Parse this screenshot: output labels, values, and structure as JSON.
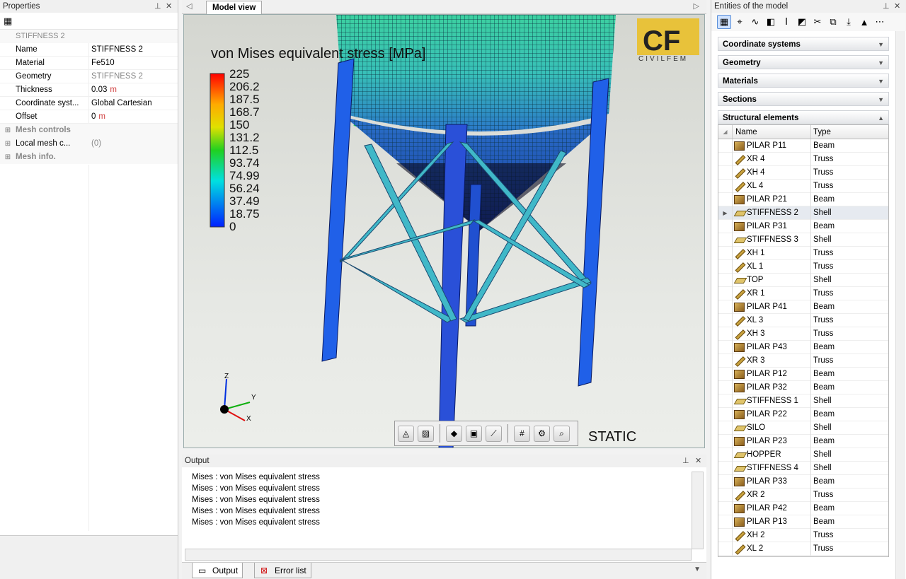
{
  "properties": {
    "title": "Properties",
    "object_name": "STIFFNESS 2",
    "rows": [
      {
        "key": "Name",
        "value": "STIFFNESS 2",
        "unit": ""
      },
      {
        "key": "Material",
        "value": "Fe510",
        "unit": ""
      },
      {
        "key": "Geometry",
        "value": "STIFFNESS 2",
        "unit": ""
      },
      {
        "key": "Thickness",
        "value": "0.03",
        "unit": "m"
      },
      {
        "key": "Coordinate syst...",
        "value": "Global Cartesian",
        "unit": ""
      },
      {
        "key": "Offset",
        "value": "0",
        "unit": "m"
      }
    ],
    "groups": [
      {
        "key": "Mesh controls",
        "value": ""
      },
      {
        "key": "Local mesh c...",
        "value": "(0)"
      },
      {
        "key": "Mesh info.",
        "value": ""
      }
    ]
  },
  "model_view": {
    "tab_label": "Model view",
    "legend_title": "von Mises equivalent stress [MPa]",
    "legend_values": [
      "225",
      "206.2",
      "187.5",
      "168.7",
      "150",
      "131.2",
      "112.5",
      "93.74",
      "74.99",
      "56.24",
      "37.49",
      "18.75",
      "0"
    ],
    "logo_text": "CIVILFEM",
    "static_label": "STATIC",
    "axes": {
      "z": "Z",
      "y": "Y",
      "x": "X"
    }
  },
  "output": {
    "title": "Output",
    "lines": [
      "Mises : von Mises equivalent stress",
      "Mises : von Mises equivalent stress",
      "Mises : von Mises equivalent stress",
      "Mises : von Mises equivalent stress",
      "Mises : von Mises equivalent stress"
    ],
    "tab_output": "Output",
    "tab_errors": "Error list"
  },
  "entities": {
    "title": "Entities of the model",
    "sections": [
      "Coordinate systems",
      "Geometry",
      "Materials",
      "Sections",
      "Structural elements"
    ],
    "col_name": "Name",
    "col_type": "Type",
    "rows": [
      {
        "name": "PILAR P11",
        "type": "Beam"
      },
      {
        "name": "XR 4",
        "type": "Truss"
      },
      {
        "name": "XH 4",
        "type": "Truss"
      },
      {
        "name": "XL 4",
        "type": "Truss"
      },
      {
        "name": "PILAR P21",
        "type": "Beam"
      },
      {
        "name": "STIFFNESS 2",
        "type": "Shell"
      },
      {
        "name": "PILAR P31",
        "type": "Beam"
      },
      {
        "name": "STIFFNESS 3",
        "type": "Shell"
      },
      {
        "name": "XH 1",
        "type": "Truss"
      },
      {
        "name": "XL 1",
        "type": "Truss"
      },
      {
        "name": "TOP",
        "type": "Shell"
      },
      {
        "name": "XR 1",
        "type": "Truss"
      },
      {
        "name": "PILAR P41",
        "type": "Beam"
      },
      {
        "name": "XL 3",
        "type": "Truss"
      },
      {
        "name": "XH 3",
        "type": "Truss"
      },
      {
        "name": "PILAR P43",
        "type": "Beam"
      },
      {
        "name": "XR 3",
        "type": "Truss"
      },
      {
        "name": "PILAR P12",
        "type": "Beam"
      },
      {
        "name": "PILAR P32",
        "type": "Beam"
      },
      {
        "name": "STIFFNESS 1",
        "type": "Shell"
      },
      {
        "name": "PILAR P22",
        "type": "Beam"
      },
      {
        "name": "SILO",
        "type": "Shell"
      },
      {
        "name": "PILAR P23",
        "type": "Beam"
      },
      {
        "name": "HOPPER",
        "type": "Shell"
      },
      {
        "name": "STIFFNESS 4",
        "type": "Shell"
      },
      {
        "name": "PILAR P33",
        "type": "Beam"
      },
      {
        "name": "XR 2",
        "type": "Truss"
      },
      {
        "name": "PILAR P42",
        "type": "Beam"
      },
      {
        "name": "PILAR P13",
        "type": "Beam"
      },
      {
        "name": "XH 2",
        "type": "Truss"
      },
      {
        "name": "XL 2",
        "type": "Truss"
      }
    ],
    "selected_index": 5
  }
}
